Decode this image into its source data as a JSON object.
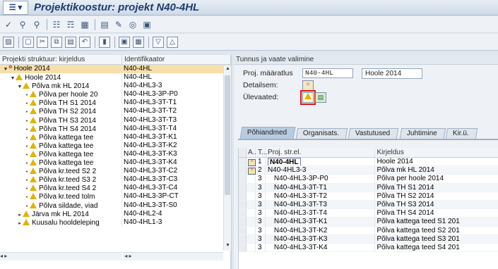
{
  "window": {
    "title": "Projektikoostur: projekt N40-4HL",
    "menu_icon": "sap-menu-icon"
  },
  "toolbar1": [
    "check-icon",
    "binoculars-icon",
    "find-next-icon",
    "hierarchy-icon",
    "structure-icon",
    "layout-icon",
    "table-icon",
    "settings-icon",
    "info-icon"
  ],
  "toolbar2": [
    "open-icon",
    "new-icon",
    "cut-icon",
    "copy-icon",
    "paste-icon",
    "undo-icon",
    "delete-icon",
    "save-icon",
    "detail-icon",
    "filter-icon",
    "collapse-icon"
  ],
  "tree": {
    "col1": "Projekti struktuur: kirjeldus",
    "col2": "Identifikaator",
    "rows": [
      {
        "text": "Hoole 2014",
        "id": "N40-4HL",
        "level": 0,
        "toggle": "▼",
        "icon": "project",
        "selected": true
      },
      {
        "text": "Hoole 2014",
        "id": "N40-4HL",
        "level": 1,
        "toggle": "▼",
        "icon": "wbs"
      },
      {
        "text": "Põlva mk HL 2014",
        "id": "N40-4HL3-3",
        "level": 2,
        "toggle": "▼",
        "icon": "wbs"
      },
      {
        "text": "Põlva per hoole 20",
        "id": "N40-4HL3-3P-P0",
        "level": 3,
        "toggle": "•",
        "icon": "wbs"
      },
      {
        "text": "Põlva TH S1 2014",
        "id": "N40-4HL3-3T-T1",
        "level": 3,
        "toggle": "•",
        "icon": "wbs"
      },
      {
        "text": "Põlva TH S2 2014",
        "id": "N40-4HL3-3T-T2",
        "level": 3,
        "toggle": "•",
        "icon": "wbs"
      },
      {
        "text": "Põlva TH S3 2014",
        "id": "N40-4HL3-3T-T3",
        "level": 3,
        "toggle": "•",
        "icon": "wbs"
      },
      {
        "text": "Põlva TH S4 2014",
        "id": "N40-4HL3-3T-T4",
        "level": 3,
        "toggle": "•",
        "icon": "wbs"
      },
      {
        "text": "Põlva kattega tee",
        "id": "N40-4HL3-3T-K1",
        "level": 3,
        "toggle": "•",
        "icon": "wbs"
      },
      {
        "text": "Põlva kattega tee",
        "id": "N40-4HL3-3T-K2",
        "level": 3,
        "toggle": "•",
        "icon": "wbs"
      },
      {
        "text": "Põlva kattega tee",
        "id": "N40-4HL3-3T-K3",
        "level": 3,
        "toggle": "•",
        "icon": "wbs"
      },
      {
        "text": "Põlva kattega tee",
        "id": "N40-4HL3-3T-K4",
        "level": 3,
        "toggle": "•",
        "icon": "wbs"
      },
      {
        "text": "Põlva kr.teed S2 2",
        "id": "N40-4HL3-3T-C2",
        "level": 3,
        "toggle": "•",
        "icon": "wbs"
      },
      {
        "text": "Põlva kr.teed S3 2",
        "id": "N40-4HL3-3T-C3",
        "level": 3,
        "toggle": "•",
        "icon": "wbs"
      },
      {
        "text": "Põlva kr.teed S4 2",
        "id": "N40-4HL3-3T-C4",
        "level": 3,
        "toggle": "•",
        "icon": "wbs"
      },
      {
        "text": "Põlva kr.teed tolm",
        "id": "N40-4HL3-3P-CT",
        "level": 3,
        "toggle": "•",
        "icon": "wbs"
      },
      {
        "text": "Põlva sildade, viad",
        "id": "N40-4HL3-3T-S0",
        "level": 3,
        "toggle": "•",
        "icon": "wbs"
      },
      {
        "text": "Järva mk HL 2014",
        "id": "N40-4HL2-4",
        "level": 2,
        "toggle": "▸",
        "icon": "wbs"
      },
      {
        "text": "Kuusalu hooldeleping",
        "id": "N40-4HL1-3",
        "level": 2,
        "toggle": "▸",
        "icon": "wbs"
      }
    ]
  },
  "right": {
    "section_title": "Tunnus ja vaate valimine",
    "proj_label": "Proj. määratlus",
    "proj_value": "N40-4HL",
    "proj_desc": "Hoole 2014",
    "detail_label": "Detailsem:",
    "overview_label": "Ülevaated:",
    "tabs": [
      "Põhiandmed",
      "Organisats.",
      "Vastutused",
      "Juhtimine",
      "Kir.ü."
    ],
    "grid": {
      "headers": [
        "A..",
        "T...",
        "Proj. str.el.",
        "Kirjeldus"
      ],
      "rows": [
        {
          "a": "icon",
          "t": "1",
          "el": "N40-4HL",
          "desc": "Hoole 2014",
          "focus": true
        },
        {
          "a": "icon",
          "t": "2",
          "el": "N40-4HL3-3",
          "desc": "Põlva mk HL 2014"
        },
        {
          "a": "",
          "t": "3",
          "el": "N40-4HL3-3P-P0",
          "desc": "Põlva per hoole 2014"
        },
        {
          "a": "",
          "t": "3",
          "el": "N40-4HL3-3T-T1",
          "desc": "Põlva TH S1 2014"
        },
        {
          "a": "",
          "t": "3",
          "el": "N40-4HL3-3T-T2",
          "desc": "Põlva TH S2 2014"
        },
        {
          "a": "",
          "t": "3",
          "el": "N40-4HL3-3T-T3",
          "desc": "Põlva TH S3 2014"
        },
        {
          "a": "",
          "t": "3",
          "el": "N40-4HL3-3T-T4",
          "desc": "Põlva TH S4 2014"
        },
        {
          "a": "",
          "t": "3",
          "el": "N40-4HL3-3T-K1",
          "desc": "Põlva kattega teed S1 201"
        },
        {
          "a": "",
          "t": "3",
          "el": "N40-4HL3-3T-K2",
          "desc": "Põlva kattega teed S2 201"
        },
        {
          "a": "",
          "t": "3",
          "el": "N40-4HL3-3T-K3",
          "desc": "Põlva kattega teed S3 201"
        },
        {
          "a": "",
          "t": "3",
          "el": "N40-4HL3-3T-K4",
          "desc": "Põlva kattega teed S4 201"
        }
      ]
    }
  },
  "colors": {
    "selection": "#f6dfa9",
    "highlight": "#e0141a",
    "title": "#1e3c6e"
  }
}
